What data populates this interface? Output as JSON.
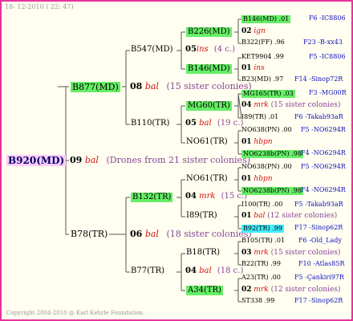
{
  "header": {
    "date": "18- 12-2010 ( 22: 47)"
  },
  "footer": {
    "copyright": "Copyright 2004-2010 @ Karl Kehrle Foundation."
  },
  "root": {
    "name": "B920(MD)"
  },
  "gen1": [
    {
      "name": "B877(MD)",
      "num": "08",
      "word": "bal",
      "note": "(15 sister colonies)"
    },
    {
      "name": "B78(TR)",
      "num": "06",
      "word": "bal",
      "note": "(18 sister colonies)"
    }
  ],
  "drones": {
    "num": "09",
    "word": "bal",
    "note": "(Drones from 21 sister colonies)"
  },
  "gen2": [
    {
      "name": "B547(MD)",
      "num": "05",
      "word": "ins",
      "note": "(4 c.)"
    },
    {
      "name": "B110(TR)",
      "num": "05",
      "word": "bal",
      "note": "(19 c.)"
    },
    {
      "name": "B132(TR)",
      "num": "04",
      "word": "mrk",
      "note": "(15 c.)"
    },
    {
      "name": "B77(TR)",
      "num": "04",
      "word": "bal",
      "note": "(18 c.)"
    }
  ],
  "gen3": [
    {
      "name": "B226(MD)",
      "num": "02",
      "word": "ign",
      "note": ""
    },
    {
      "name": "B146(MD)",
      "num": "01",
      "word": "ins",
      "note": ""
    },
    {
      "name": "MG60(TR)",
      "num": "04",
      "word": "mrk",
      "note": "(15 sister colonies)"
    },
    {
      "name": "NO61(TR)",
      "num": "01",
      "word": "hbpn",
      "note": ""
    },
    {
      "name": "NO61(TR)",
      "num": "01",
      "word": "hbpn",
      "note": ""
    },
    {
      "name": "I89(TR)",
      "num": "01",
      "word": "bal",
      "note": "(12 sister colonies)"
    },
    {
      "name": "B18(TR)",
      "num": "03",
      "word": "mrk",
      "note": "(15 sister colonies)"
    },
    {
      "name": "A34(TR)",
      "num": "02",
      "word": "mrk",
      "note": "(12 sister colonies)"
    }
  ],
  "gen4": [
    {
      "left": "B146(MD) .01",
      "right": "F6 -IC8806"
    },
    {
      "left": "B322(FF) .96",
      "right": "F23 -B-xx43"
    },
    {
      "left": "KET9904 .99",
      "right": "F5 -IC8806"
    },
    {
      "left": "B23(MD) .97",
      "right": "F14 -Sinop72R"
    },
    {
      "left": "MG165(TR) .03",
      "right": "F3 -MG00R"
    },
    {
      "left": "I89(TR) .01",
      "right": "F6 -Takab93aR"
    },
    {
      "left": "NO638(PN) .00",
      "right": "F5 -NO6294R"
    },
    {
      "left": "NO6238b(PN) .98",
      "right": "F4 -NO6294R"
    },
    {
      "left": "NO638(PN) .00",
      "right": "F5 -NO6294R"
    },
    {
      "left": "NO6238b(PN) .98",
      "right": "F4 -NO6294R"
    },
    {
      "left": "I100(TR) .00",
      "right": "F5 -Takab93aR"
    },
    {
      "left": "B92(TR) .99",
      "right": "F17 -Sinop62R"
    },
    {
      "left": "B105(TR) .01",
      "right": "F6 -Old_Lady"
    },
    {
      "left": "B22(TR) .99",
      "right": "F10 -Atlas85R"
    },
    {
      "left": "A23(TR) .00",
      "right": "F5 -Çankiri97R"
    },
    {
      "left": "ST338 .99",
      "right": "F17 -Sinop62R"
    }
  ]
}
